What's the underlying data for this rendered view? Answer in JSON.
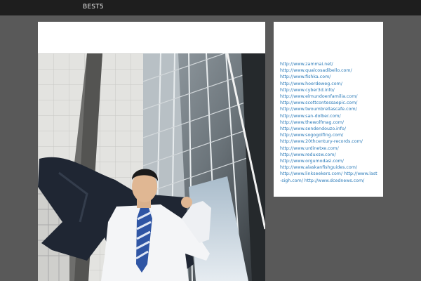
{
  "header": {
    "brand": "BEST5"
  },
  "hero": {
    "image": "businessman-with-jacket-in-wind"
  },
  "sidebar": {
    "links": [
      "http://www.zammai.net/",
      "http://www.qualcosadibello.com/",
      "http://www.fishka.com/",
      "http://www.hoerdeweg.com/",
      "http://www.cyber3d.info/",
      "http://www.elmundoenfamilia.com/",
      "http://www.scottcontessaepic.com/",
      "http://www.twoumbrellascafe.com/",
      "http://www.san-dolber.com/",
      "http://www.thewolfmag.com/",
      "http://www.sendendouzo.info/",
      "http://www.sogogolfing.com/",
      "http://www.20thcentury-records.com/",
      "http://www.urdinetxe.com/",
      "http://www.reduxsw.com/",
      "http://www.orgumodasi.com/",
      "http://www.alaskanfishguides.com/"
    ],
    "inline_links": [
      "http://www.linkseekers.com/",
      "http://www.last-sigh.com/",
      "http://www.dcednews.com/"
    ]
  }
}
